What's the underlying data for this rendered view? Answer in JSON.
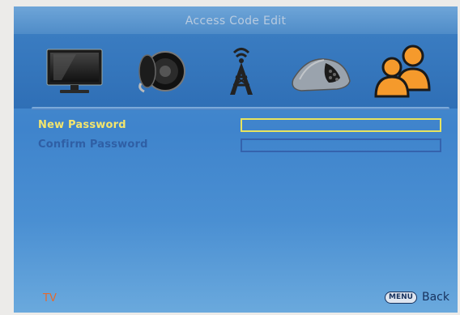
{
  "header": {
    "title": "Access Code Edit"
  },
  "menu": {
    "icons": [
      {
        "name": "tv-icon",
        "selected": false
      },
      {
        "name": "speaker-icon",
        "selected": false
      },
      {
        "name": "antenna-tower-icon",
        "selected": false
      },
      {
        "name": "satellite-dish-icon",
        "selected": false
      },
      {
        "name": "users-icon",
        "selected": true
      }
    ]
  },
  "form": {
    "new_password_label": "New Password",
    "confirm_password_label": "Confirm Password",
    "new_password_value": "",
    "confirm_password_value": ""
  },
  "footer": {
    "source": "TV",
    "menu_key": "MENU",
    "back": "Back"
  },
  "colors": {
    "active_label": "#f4e56c",
    "inactive_label": "#2f5fa5",
    "source_label": "#e56a2e",
    "selected_icon": "#f59a2c"
  }
}
